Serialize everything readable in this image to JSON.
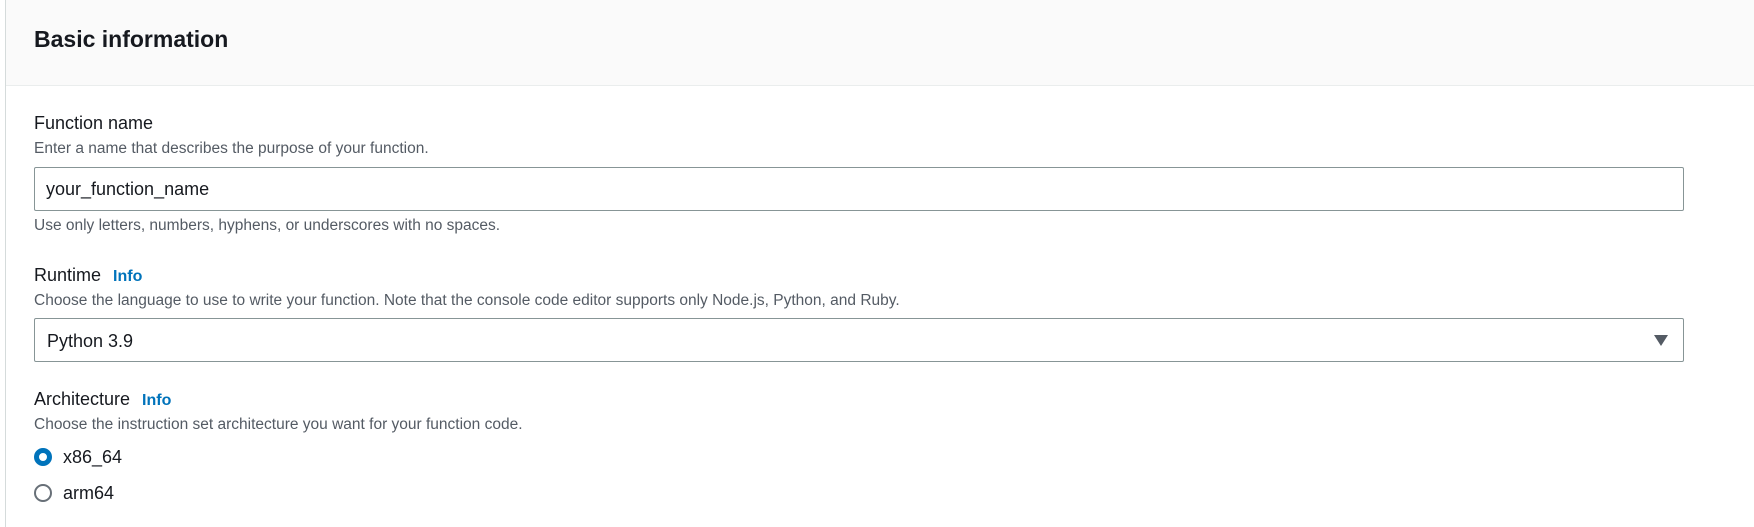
{
  "section": {
    "title": "Basic information"
  },
  "function_name": {
    "label": "Function name",
    "description": "Enter a name that describes the purpose of your function.",
    "value": "your_function_name",
    "constraint": "Use only letters, numbers, hyphens, or underscores with no spaces."
  },
  "runtime": {
    "label": "Runtime",
    "info_link": "Info",
    "description": "Choose the language to use to write your function. Note that the console code editor supports only Node.js, Python, and Ruby.",
    "selected": "Python 3.9",
    "icon": "caret-down-icon"
  },
  "architecture": {
    "label": "Architecture",
    "info_link": "Info",
    "description": "Choose the instruction set architecture you want for your function code.",
    "options": [
      {
        "label": "x86_64",
        "checked": true
      },
      {
        "label": "arm64",
        "checked": false
      }
    ]
  },
  "colors": {
    "accent": "#0073bb",
    "text": "#16191f",
    "secondary_text": "#545b64",
    "border": "#879596",
    "header_bg": "#fafafa"
  }
}
